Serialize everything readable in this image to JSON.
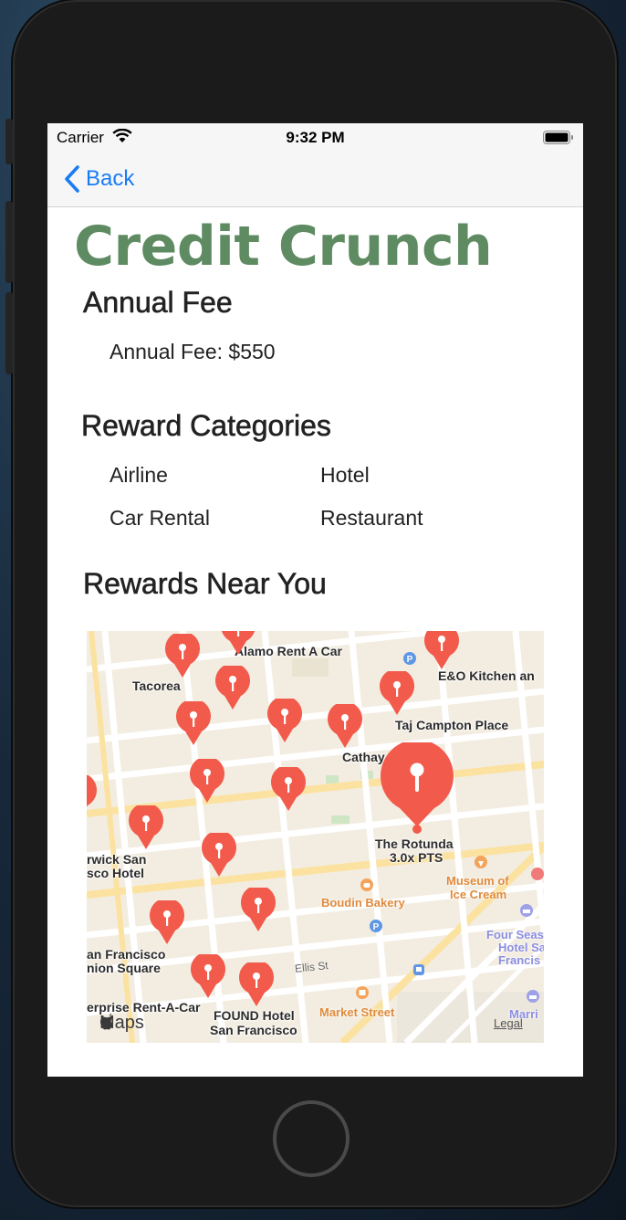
{
  "status_bar": {
    "carrier": "Carrier",
    "time": "9:32 PM"
  },
  "nav": {
    "back_label": "Back"
  },
  "app_title": "Credit Crunch",
  "annual_fee": {
    "heading": "Annual Fee",
    "text": "Annual Fee: $550"
  },
  "reward_categories": {
    "heading": "Reward Categories",
    "items": [
      "Airline",
      "Hotel",
      "Car Rental",
      "Restaurant"
    ]
  },
  "rewards_near_you": {
    "heading": "Rewards Near You",
    "map": {
      "selected_place": "The Rotunda",
      "selected_points": "3.0x PTS",
      "place_labels": [
        "Alamo Rent A Car",
        "E&O Kitchen an",
        "Tacorea",
        "Taj Campton Place",
        "Cathay",
        "rwick San",
        "sco Hotel",
        "an Francisco",
        "nion Square",
        "erprise Rent-A-Car",
        "FOUND Hotel",
        "San Francisco"
      ],
      "poi_labels": [
        "Museum of",
        "Ice Cream",
        "Boudin Bakery",
        "Four Seas",
        "Hotel Sa",
        "Francis",
        "Market Street",
        "Marri"
      ],
      "street_labels": [
        "Ellis St"
      ],
      "attribution": "Maps",
      "legal": "Legal"
    }
  },
  "colors": {
    "title_green": "#5e8b61",
    "link_blue": "#1a7cf5",
    "pin_red": "#f25b4b"
  },
  "icons": [
    "wifi-icon",
    "battery-icon",
    "back-chevron-icon",
    "map-pin-icon",
    "apple-logo-icon",
    "home-button"
  ]
}
